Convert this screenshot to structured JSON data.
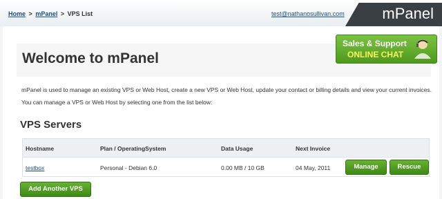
{
  "breadcrumb": {
    "home": "Home",
    "sep1": ">",
    "mpanel": "mPanel",
    "sep2": ">",
    "current": "VPS List"
  },
  "user_email": "test@nathanosullivan.com",
  "brand": "mPanel",
  "welcome_title": "Welcome to mPanel",
  "chat": {
    "line1": "Sales & Support",
    "line2": "ONLINE CHAT"
  },
  "intro": [
    "mPanel is used to manage an existing VPS or Web Host, create a new VPS or Web Host, update your contact or billing details and view your current invoices.",
    "You can manage a VPS or Web Host by selecting one from the list below:"
  ],
  "section_title": "VPS Servers",
  "table": {
    "headers": [
      "Hostname",
      "Plan / OperatingSystem",
      "Data Usage",
      "Next Invoice"
    ],
    "rows": [
      {
        "hostname": "testbox",
        "plan": "Personal - Debian 6.0",
        "usage": "0.00 MB / 10 GB",
        "invoice": "04 May, 2011",
        "manage": "Manage",
        "rescue": "Rescue"
      }
    ]
  },
  "add_button": "Add Another VPS",
  "colors": {
    "accent_green": "#4e9a1e",
    "link_blue": "#1a4f8b",
    "brand_dark": "#3a3f44",
    "chat_highlight": "#fff45a"
  }
}
